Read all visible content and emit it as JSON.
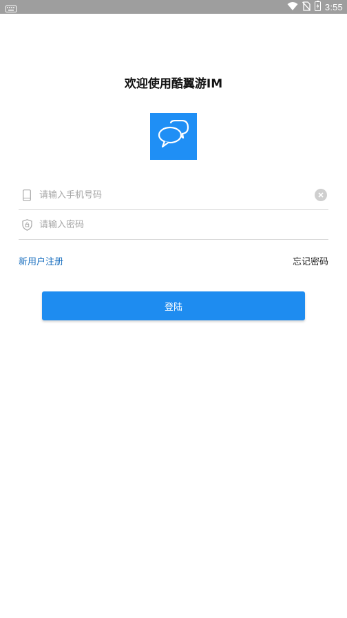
{
  "status_bar": {
    "time": "3:55",
    "icons": [
      "keyboard-icon",
      "wifi-icon",
      "no-sim-icon",
      "battery-icon"
    ]
  },
  "login": {
    "title": "欢迎使用酷翼游IM",
    "phone_placeholder": "请输入手机号码",
    "password_placeholder": "请输入密码",
    "register_label": "新用户注册",
    "forgot_label": "忘记密码",
    "login_label": "登陆"
  },
  "colors": {
    "accent": "#1e8cf0",
    "link": "#1a6fbf",
    "status_bar": "#9e9e9e"
  }
}
